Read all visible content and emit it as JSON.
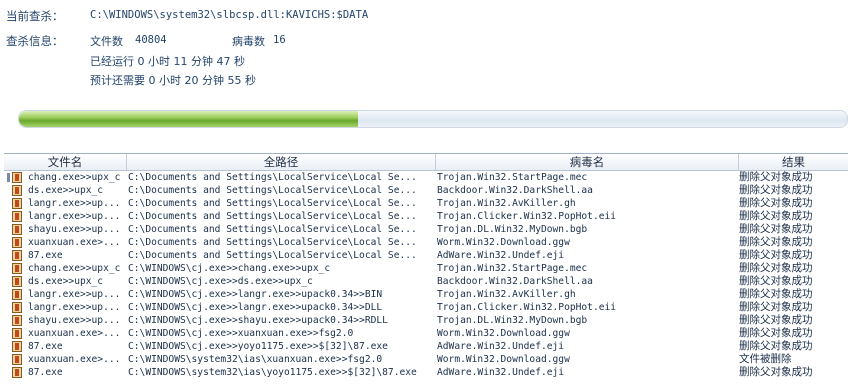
{
  "header": {
    "current_label": "当前查杀：",
    "current_path": "C:\\WINDOWS\\system32\\slbcsp.dll:KAVICHS:$DATA",
    "info_label": "查杀信息：",
    "file_count_label": "文件数",
    "file_count": "40804",
    "virus_count_label": "病毒数",
    "virus_count": "16",
    "elapsed": "已经运行 0 小时 11 分钟 47  秒",
    "remaining": "预计还需要 0 小时 20 分钟 55  秒"
  },
  "progress": {
    "fraction": 0.41
  },
  "table": {
    "columns": [
      "文件名",
      "全路径",
      "病毒名",
      "结果"
    ],
    "rows": [
      [
        "chang.exe>>upx_c",
        "C:\\Documents and Settings\\LocalService\\Local Se...",
        "Trojan.Win32.StartPage.mec",
        "删除父对象成功"
      ],
      [
        "ds.exe>>upx_c",
        "C:\\Documents and Settings\\LocalService\\Local Se...",
        "Backdoor.Win32.DarkShell.aa",
        "删除父对象成功"
      ],
      [
        "langr.exe>>up...",
        "C:\\Documents and Settings\\LocalService\\Local Se...",
        "Trojan.Win32.AvKiller.gh",
        "删除父对象成功"
      ],
      [
        "langr.exe>>up...",
        "C:\\Documents and Settings\\LocalService\\Local Se...",
        "Trojan.Clicker.Win32.PopHot.eii",
        "删除父对象成功"
      ],
      [
        "shayu.exe>>up...",
        "C:\\Documents and Settings\\LocalService\\Local Se...",
        "Trojan.DL.Win32.MyDown.bgb",
        "删除父对象成功"
      ],
      [
        "xuanxuan.exe>...",
        "C:\\Documents and Settings\\LocalService\\Local Se...",
        "Worm.Win32.Download.ggw",
        "删除父对象成功"
      ],
      [
        "87.exe",
        "C:\\Documents and Settings\\LocalService\\Local Se...",
        "AdWare.Win32.Undef.eji",
        "删除父对象成功"
      ],
      [
        "chang.exe>>upx_c",
        "C:\\WINDOWS\\cj.exe>>chang.exe>>upx_c",
        "Trojan.Win32.StartPage.mec",
        "删除父对象成功"
      ],
      [
        "ds.exe>>upx_c",
        "C:\\WINDOWS\\cj.exe>>ds.exe>>upx_c",
        "Backdoor.Win32.DarkShell.aa",
        "删除父对象成功"
      ],
      [
        "langr.exe>>up...",
        "C:\\WINDOWS\\cj.exe>>langr.exe>>upack0.34>>BIN",
        "Trojan.Win32.AvKiller.gh",
        "删除父对象成功"
      ],
      [
        "langr.exe>>up...",
        "C:\\WINDOWS\\cj.exe>>langr.exe>>upack0.34>>DLL",
        "Trojan.Clicker.Win32.PopHot.eii",
        "删除父对象成功"
      ],
      [
        "shayu.exe>>up...",
        "C:\\WINDOWS\\cj.exe>>shayu.exe>>upack0.34>>RDLL",
        "Trojan.DL.Win32.MyDown.bgb",
        "删除父对象成功"
      ],
      [
        "xuanxuan.exe>...",
        "C:\\WINDOWS\\cj.exe>>xuanxuan.exe>>fsg2.0",
        "Worm.Win32.Download.ggw",
        "删除父对象成功"
      ],
      [
        "87.exe",
        "C:\\WINDOWS\\cj.exe>>yoyo1175.exe>>$[32]\\87.exe",
        "AdWare.Win32.Undef.eji",
        "删除父对象成功"
      ],
      [
        "xuanxuan.exe>...",
        "C:\\WINDOWS\\system32\\ias\\xuanxuan.exe>>fsg2.0",
        "Worm.Win32.Download.ggw",
        "文件被删除"
      ],
      [
        "87.exe",
        "C:\\WINDOWS\\system32\\ias\\yoyo1175.exe>>$[32]\\87.exe",
        "AdWare.Win32.Undef.eji",
        "删除父对象成功"
      ]
    ]
  }
}
